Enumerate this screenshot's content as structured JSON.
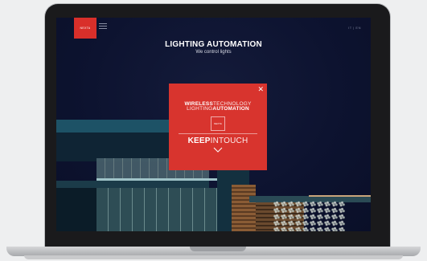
{
  "header": {
    "logo_text": "NEXTA",
    "language": "IT | EN"
  },
  "hero": {
    "title": "LIGHTING AUTOMATION",
    "subtitle": "We control lights"
  },
  "popup": {
    "line1_strong": "WIRELESS",
    "line1_thin": "TECHNOLOGY",
    "line2_thin": "LIGHTING",
    "line2_strong": "AUTOMATION",
    "logo_text": "NEXTA",
    "cta_strong": "KEEP",
    "cta_thin": "INTOUCH",
    "close_symbol": "✕"
  },
  "colors": {
    "accent": "#d8342e",
    "background": "#0d1330"
  },
  "icons": [
    "menu-icon",
    "close-icon",
    "chevron-down-icon"
  ]
}
